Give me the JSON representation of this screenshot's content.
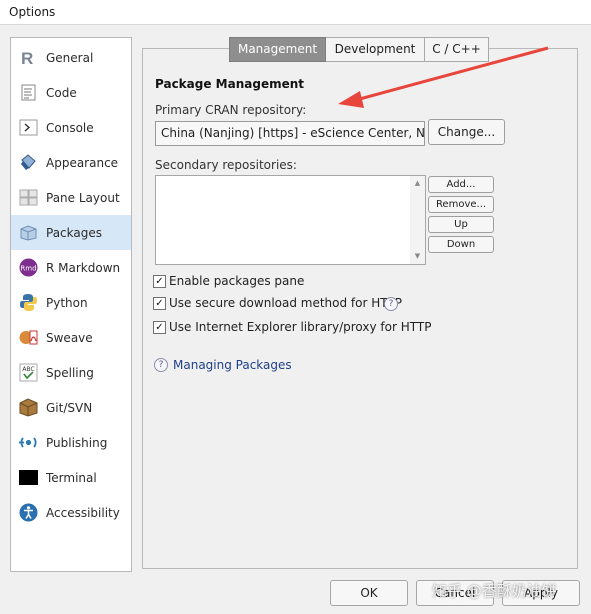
{
  "window": {
    "title": "Options"
  },
  "sidebar": {
    "items": [
      {
        "label": "General",
        "icon": "r-logo-icon"
      },
      {
        "label": "Code",
        "icon": "code-document-icon"
      },
      {
        "label": "Console",
        "icon": "console-prompt-icon"
      },
      {
        "label": "Appearance",
        "icon": "paint-bucket-icon"
      },
      {
        "label": "Pane Layout",
        "icon": "pane-grid-icon"
      },
      {
        "label": "Packages",
        "icon": "package-box-icon",
        "selected": true
      },
      {
        "label": "R Markdown",
        "icon": "rmd-badge-icon"
      },
      {
        "label": "Python",
        "icon": "python-logo-icon"
      },
      {
        "label": "Sweave",
        "icon": "sweave-pdf-icon"
      },
      {
        "label": "Spelling",
        "icon": "spellcheck-icon"
      },
      {
        "label": "Git/SVN",
        "icon": "git-box-icon"
      },
      {
        "label": "Publishing",
        "icon": "publish-broadcast-icon"
      },
      {
        "label": "Terminal",
        "icon": "terminal-black-icon"
      },
      {
        "label": "Accessibility",
        "icon": "accessibility-person-icon"
      }
    ]
  },
  "tabs": [
    {
      "label": "Management",
      "active": true
    },
    {
      "label": "Development"
    },
    {
      "label": "C / C++"
    }
  ],
  "packages": {
    "section_title": "Package Management",
    "primary_label": "Primary CRAN repository:",
    "primary_value": "China (Nanjing) [https] - eScience Center, Nanjing University",
    "change_label": "Change...",
    "secondary_label": "Secondary repositories:",
    "add_label": "Add...",
    "remove_label": "Remove...",
    "up_label": "Up",
    "down_label": "Down",
    "enable_pane_label": "Enable packages pane",
    "secure_download_label": "Use secure download method for HTTP",
    "ie_proxy_label": "Use Internet Explorer library/proxy for HTTP",
    "help_link": "Managing Packages"
  },
  "footer": {
    "ok": "OK",
    "cancel": "Cancel",
    "apply": "Apply"
  },
  "watermark": "知乎 @香酥奶油饼",
  "colors": {
    "selected_bg": "#d6e8f8",
    "active_tab": "#8e8e8e",
    "annotation_arrow": "#e8453c",
    "link": "#1f3f8a"
  }
}
